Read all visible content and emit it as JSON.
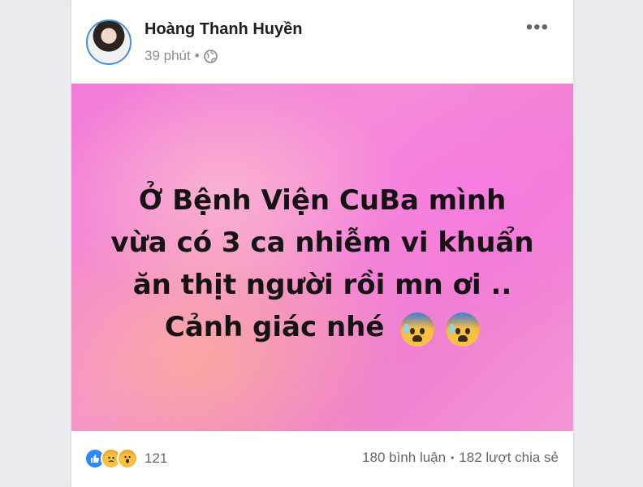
{
  "post": {
    "author": "Hoàng Thanh Huyền",
    "time": "39 phút",
    "separator": "•",
    "privacy_icon": "globe-icon",
    "more_label": "•••",
    "text_lines": [
      "Ở Bệnh Viện CuBa mình",
      "vừa có 3 ca nhiễm vi khuẩn",
      "ăn thịt người rồi mn ơi ..",
      "Cảnh giác nhé"
    ],
    "emojis": [
      "anxious-face-with-sweat-icon",
      "anxious-face-with-sweat-icon"
    ],
    "background_colors": [
      "#f37ad9",
      "#f596d6"
    ]
  },
  "footer": {
    "reaction_icons": [
      "like-icon",
      "sad-icon",
      "wow-icon"
    ],
    "reaction_count": "121",
    "comments": "180 bình luận",
    "dot": "•",
    "shares": "182 lượt chia sẻ"
  },
  "colors": {
    "accent": "#2d88ff",
    "muted_text": "#8a8d91",
    "name_text": "#1c1e21"
  }
}
